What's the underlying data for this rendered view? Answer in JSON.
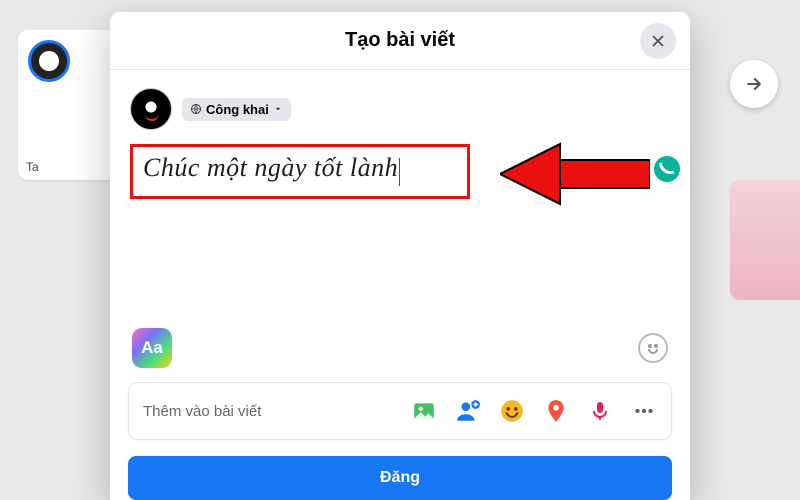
{
  "modal": {
    "title": "Tạo bài viết",
    "close_icon": "close-icon"
  },
  "user": {
    "privacy_label": "Công khai"
  },
  "post": {
    "text": "Chúc một ngày tốt lành"
  },
  "format": {
    "aa_label": "Aa"
  },
  "attach": {
    "label": "Thêm vào bài viết"
  },
  "submit": {
    "label": "Đăng"
  },
  "story": {
    "label": "Ta"
  }
}
